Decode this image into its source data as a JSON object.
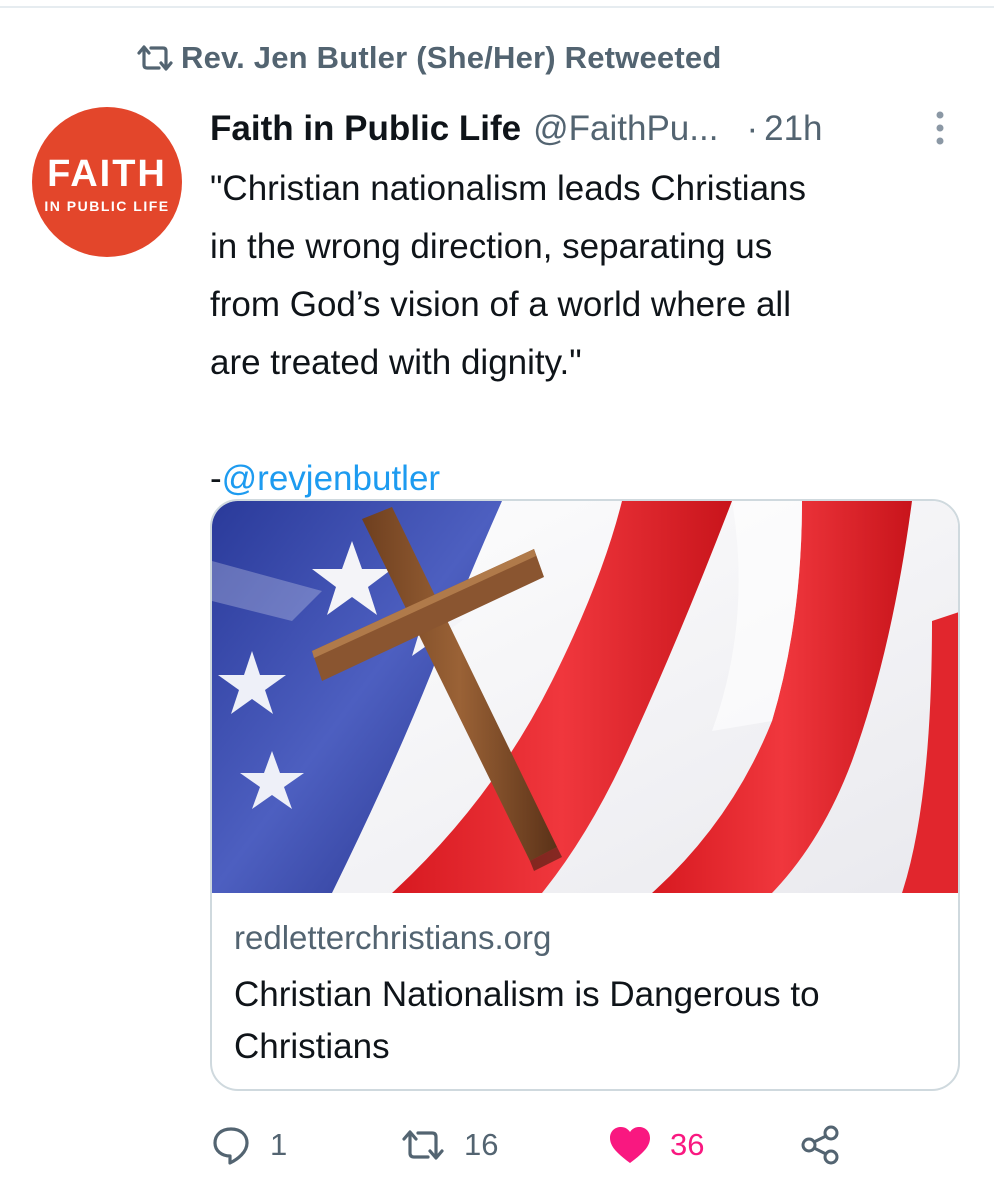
{
  "retweet": {
    "icon": "retweet-icon",
    "label": "Rev. Jen Butler (She/Her) Retweeted"
  },
  "author": {
    "avatar_line1": "FAITH",
    "avatar_line2": "IN PUBLIC LIFE",
    "avatar_color": "#e3462b",
    "name": "Faith in Public Life",
    "handle": "@FaithPu...",
    "separator": "·",
    "time": "21h"
  },
  "tweet": {
    "lines": [
      "\"Christian nationalism leads Christians",
      "in the wrong direction, separating us",
      "from God’s vision of a world where all",
      "are treated with dignity.\""
    ],
    "mention_prefix": "-",
    "mention": "@revjenbutler"
  },
  "card": {
    "image_description_icon": "flag-with-cross-image",
    "domain": "redletterchristians.org",
    "title": "Christian Nationalism is Dangerous to Christians"
  },
  "actions": {
    "reply_icon": "reply-icon",
    "reply_count": "1",
    "retweet_icon": "retweet-icon",
    "retweet_count": "16",
    "like_icon": "heart-icon",
    "like_count": "36",
    "share_icon": "share-icon",
    "like_color": "#f91880"
  },
  "colors": {
    "text_primary": "#0f1419",
    "text_secondary": "#536471",
    "link": "#1d9bf0",
    "border": "#cfd9de"
  }
}
